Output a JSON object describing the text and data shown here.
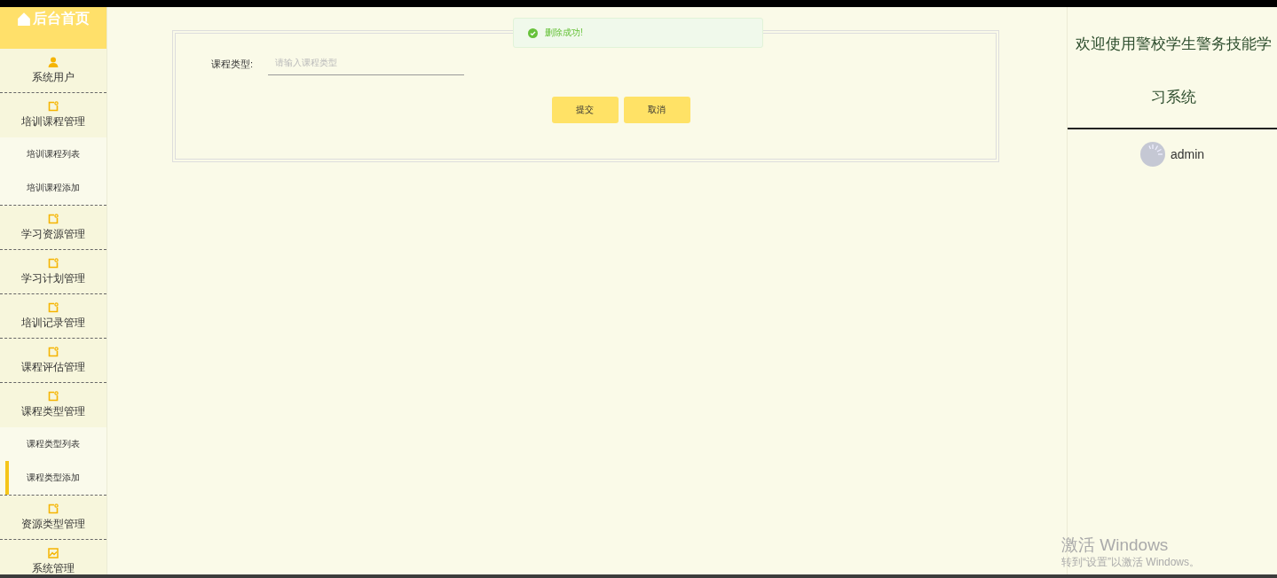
{
  "sidebar": {
    "home": {
      "label": "后台首页"
    },
    "items": [
      {
        "label": "系统用户",
        "kind": "person",
        "expanded": false
      },
      {
        "label": "培训课程管理",
        "kind": "edit",
        "expanded": true,
        "children": [
          {
            "label": "培训课程列表",
            "selected": false
          },
          {
            "label": "培训课程添加",
            "selected": false
          }
        ]
      },
      {
        "label": "学习资源管理",
        "kind": "edit",
        "expanded": false
      },
      {
        "label": "学习计划管理",
        "kind": "edit",
        "expanded": false
      },
      {
        "label": "培训记录管理",
        "kind": "edit",
        "expanded": false
      },
      {
        "label": "课程评估管理",
        "kind": "edit",
        "expanded": false
      },
      {
        "label": "课程类型管理",
        "kind": "edit",
        "expanded": true,
        "children": [
          {
            "label": "课程类型列表",
            "selected": false
          },
          {
            "label": "课程类型添加",
            "selected": true
          }
        ]
      },
      {
        "label": "资源类型管理",
        "kind": "edit",
        "expanded": false
      },
      {
        "label": "系统管理",
        "kind": "image",
        "expanded": false
      }
    ]
  },
  "form": {
    "fields": [
      {
        "label": "课程类型:",
        "placeholder": "请输入课程类型"
      }
    ],
    "buttons": [
      "提交",
      "取消"
    ]
  },
  "toast": {
    "kind": "success",
    "message": "删除成功!"
  },
  "right_panel": {
    "title": "欢迎使用警校学生警务技能学习系统",
    "user": "admin"
  },
  "os_overlay": {
    "title": "激活 Windows",
    "subtitle": "转到“设置”以激活 Windows。"
  }
}
